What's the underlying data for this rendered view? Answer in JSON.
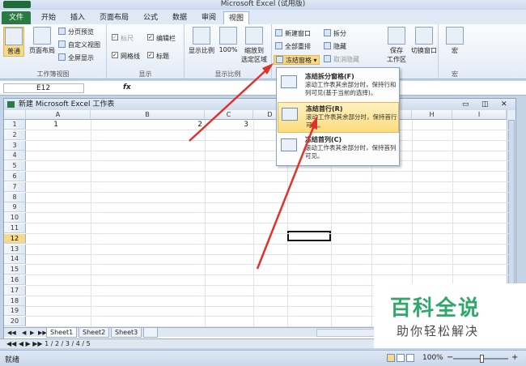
{
  "window": {
    "title": "Microsoft Excel (试用版)"
  },
  "tabs": [
    "文件",
    "开始",
    "插入",
    "页面布局",
    "公式",
    "数据",
    "审阅",
    "视图"
  ],
  "ribbon": {
    "workbook_views": {
      "label": "工作簿视图",
      "normal": "普通",
      "page_layout": "页面布局",
      "page_break": "分页预览",
      "custom_views": "自定义视图",
      "full_screen": "全屏显示"
    },
    "show": {
      "label": "显示",
      "ruler": "标尺",
      "formula_bar": "编辑栏",
      "gridlines": "网格线",
      "headings": "标题"
    },
    "zoom": {
      "label": "显示比例",
      "zoom": "显示比例",
      "zoom100": "100%",
      "zoom_selection_l1": "缩放到",
      "zoom_selection_l2": "选定区域"
    },
    "window": {
      "new_window": "新建窗口",
      "arrange_all": "全部重排",
      "freeze_panes": "冻结窗格",
      "split": "拆分",
      "hide": "隐藏",
      "unhide": "取消隐藏",
      "save_workspace_l1": "保存",
      "save_workspace_l2": "工作区",
      "switch_windows": "切换窗口"
    },
    "macros": {
      "label": "宏",
      "macros": "宏"
    }
  },
  "formula_bar": {
    "name_box": "E12",
    "fx": "fx"
  },
  "workbook": {
    "title": "新建 Microsoft Excel 工作表",
    "columns": [
      "A",
      "B",
      "C",
      "D",
      "E",
      "F",
      "G",
      "H",
      "I"
    ],
    "rows": [
      "1",
      "2",
      "3",
      "4",
      "5",
      "6",
      "7",
      "8",
      "9",
      "10",
      "11",
      "12",
      "13",
      "14",
      "15",
      "16",
      "17",
      "18",
      "19",
      "20"
    ],
    "cells": {
      "A1": "1",
      "B1": "2",
      "C1": "3"
    },
    "sheets": [
      "Sheet1",
      "Sheet2",
      "Sheet3"
    ]
  },
  "outer_sheet_tabs": "1 / 2 / 3 / 4 / 5",
  "freeze_menu": [
    {
      "title": "冻结拆分窗格(F)",
      "desc": "滚动工作表其余部分时，保持行和列可见(基于当前的选择)。"
    },
    {
      "title": "冻结首行(R)",
      "desc": "滚动工作表其余部分时，保持首行可见。"
    },
    {
      "title": "冻结首列(C)",
      "desc": "滚动工作表其余部分时，保持首列可见。"
    }
  ],
  "status": {
    "text": "就绪",
    "zoom": "100%"
  },
  "watermark": {
    "line1": "百科全说",
    "line2": "助你轻松解决"
  }
}
